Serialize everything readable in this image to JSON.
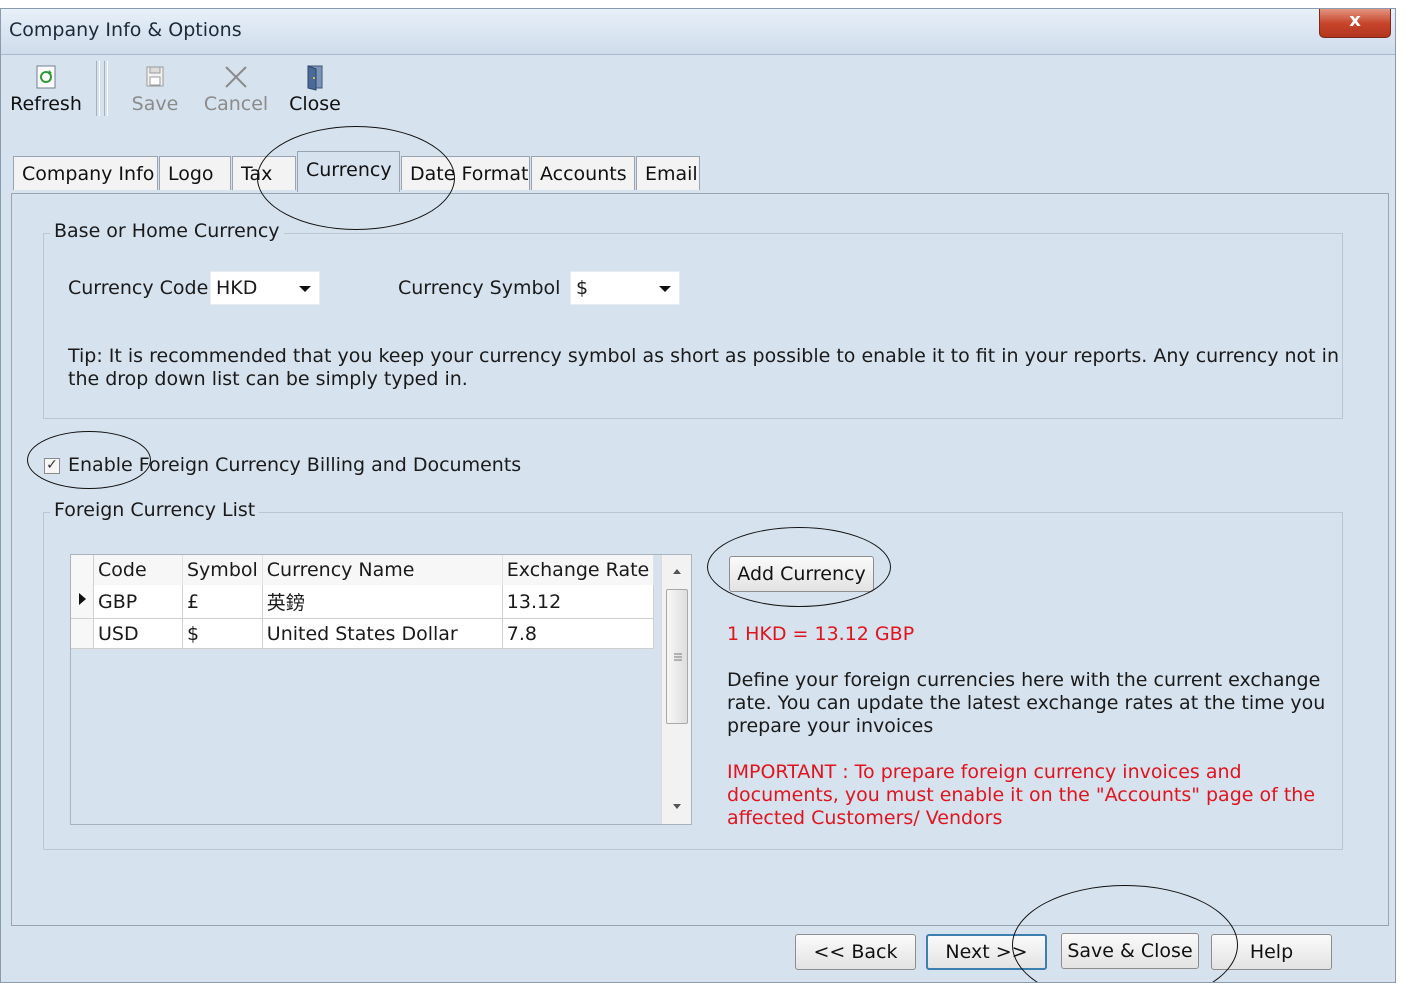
{
  "window": {
    "title": "Company Info & Options",
    "close_glyph": "x"
  },
  "toolbar": {
    "refresh_label": "Refresh",
    "save_label": "Save",
    "cancel_label": "Cancel",
    "close_label": "Close"
  },
  "tabs": [
    {
      "label": "Company Info"
    },
    {
      "label": "Logo"
    },
    {
      "label": "Tax"
    },
    {
      "label": "Currency",
      "active": true
    },
    {
      "label": "Date Format"
    },
    {
      "label": "Accounts"
    },
    {
      "label": "Email"
    }
  ],
  "base_currency": {
    "group_title": "Base or Home Currency",
    "code_label": "Currency Code",
    "code_value": "HKD",
    "symbol_label": "Currency Symbol",
    "symbol_value": "$",
    "tip_line1": "Tip: It is recommended that you keep your currency symbol as short as possible to enable it to fit in your reports. Any currency not in",
    "tip_line2": "the drop down list can be simply typed in."
  },
  "foreign": {
    "enable_label": "Enable Foreign Currency Billing and Documents",
    "enabled": true,
    "group_title": "Foreign Currency List",
    "columns": [
      "Code",
      "Symbol",
      "Currency Name",
      "Exchange Rate"
    ],
    "rows": [
      {
        "code": "GBP",
        "symbol": "£",
        "name": "英鎊",
        "rate": "13.12"
      },
      {
        "code": "USD",
        "symbol": "$",
        "name": "United States Dollar",
        "rate": "7.8"
      }
    ],
    "add_button": "Add Currency",
    "conversion": "1 HKD = 13.12 GBP",
    "info_line1": "Define your foreign currencies here with the current exchange",
    "info_line2": "rate. You can update the latest exchange rates at the time you",
    "info_line3": "prepare your invoices",
    "important_line1": "IMPORTANT : To prepare foreign currency invoices and",
    "important_line2": "documents, you must enable it on the \"Accounts\" page of the",
    "important_line3": "affected Customers/ Vendors"
  },
  "footer": {
    "back_label": "<< Back",
    "next_label": "Next >>",
    "save_close_label": "Save & Close",
    "help_label": "Help"
  },
  "colors": {
    "window_bg": "#d6e2ee",
    "important_text": "#e0141e",
    "close_button": "#c7442a"
  }
}
